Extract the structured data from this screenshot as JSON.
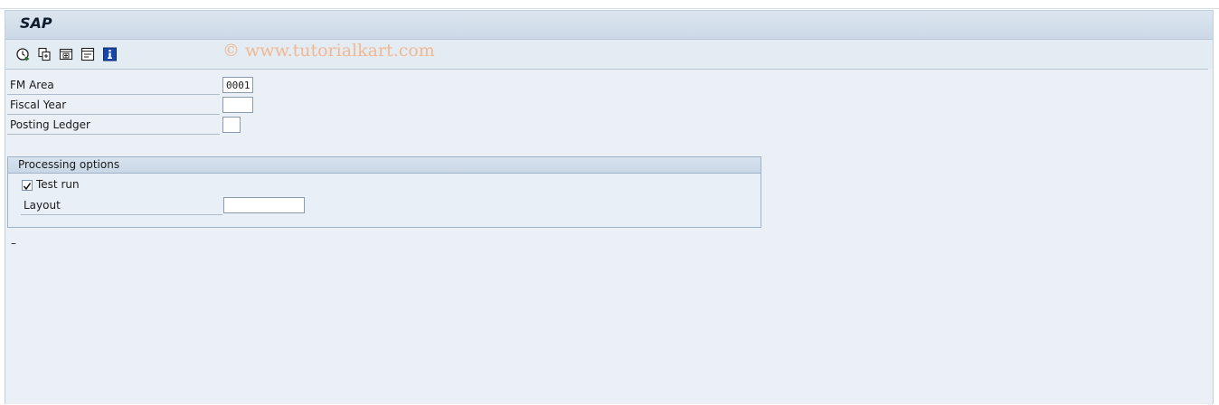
{
  "window": {
    "title": "SAP"
  },
  "watermark": "© www.tutorialkart.com",
  "toolbar": {
    "buttons": [
      {
        "name": "execute",
        "icon": "execute-clock-icon"
      },
      {
        "name": "get-variant",
        "icon": "get-variant-icon"
      },
      {
        "name": "dynamic-selections",
        "icon": "dynamic-selections-icon"
      },
      {
        "name": "selection-options",
        "icon": "selection-options-icon"
      },
      {
        "name": "information",
        "icon": "info-icon"
      }
    ]
  },
  "form": {
    "fm_area": {
      "label": "FM Area",
      "value": "0001"
    },
    "fiscal_year": {
      "label": "Fiscal Year",
      "value": ""
    },
    "posting_ledger": {
      "label": "Posting Ledger",
      "value": ""
    }
  },
  "processing_options": {
    "title": "Processing options",
    "test_run": {
      "label": "Test run",
      "checked": true
    },
    "layout": {
      "label": "Layout",
      "value": ""
    }
  },
  "status": {
    "text": "–"
  },
  "colors": {
    "background": "#eaf0f6",
    "title_bar": "#cbd8e6",
    "watermark": "#f2b892",
    "info_icon": "#1646a8"
  }
}
